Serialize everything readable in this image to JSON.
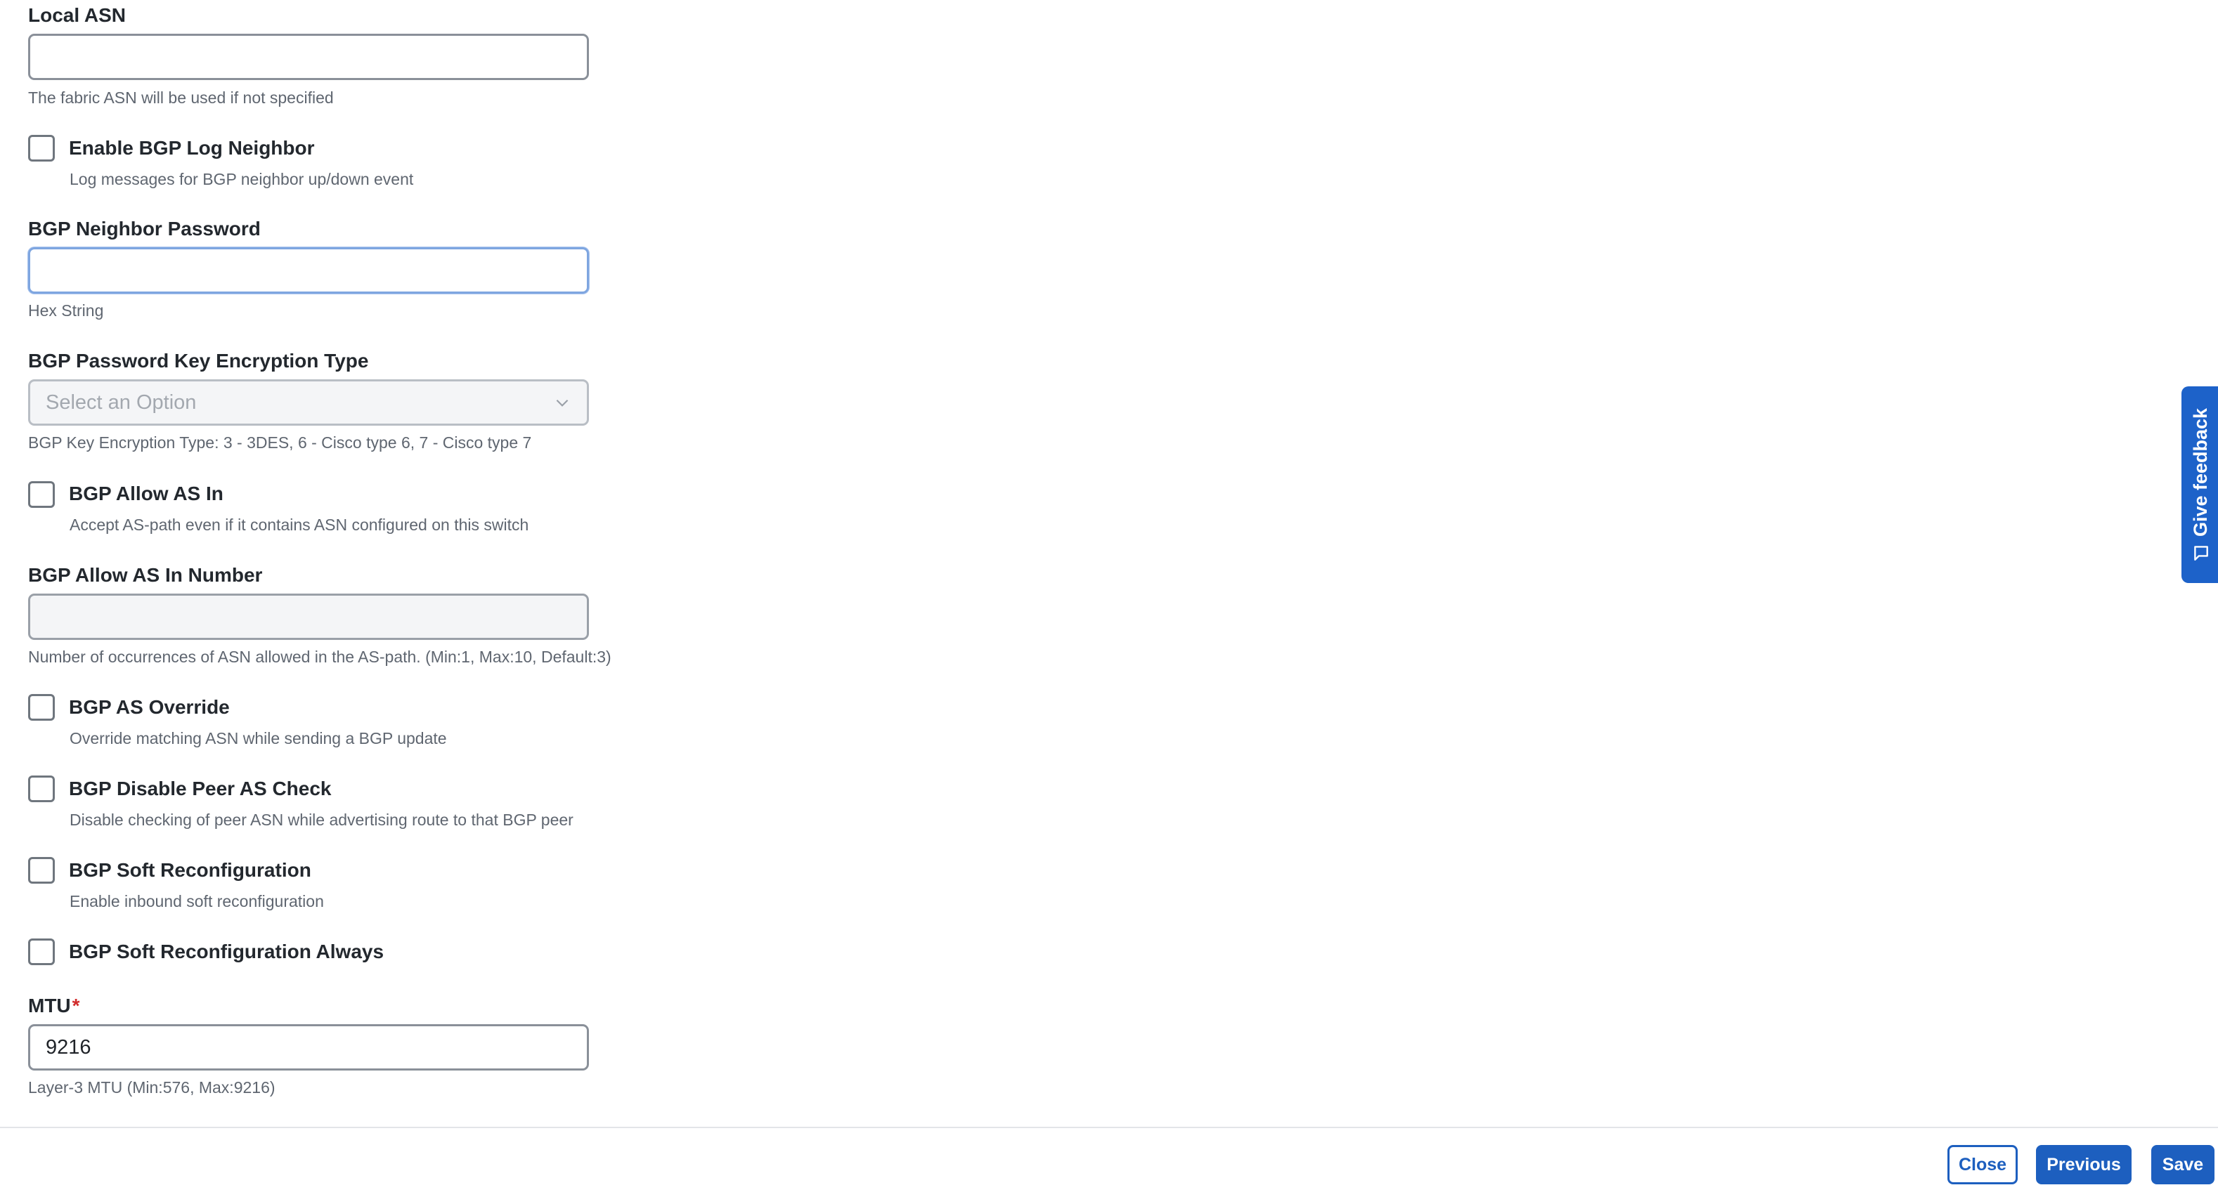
{
  "fields": {
    "local_asn": {
      "label": "Local ASN",
      "value": "",
      "help": "The fabric ASN will be used if not specified"
    },
    "log_neighbor": {
      "label": "Enable BGP Log Neighbor",
      "help": "Log messages for BGP neighbor up/down event",
      "checked": false
    },
    "neighbor_password": {
      "label": "BGP Neighbor Password",
      "value": "",
      "help": "Hex String"
    },
    "key_encryption": {
      "label": "BGP Password Key Encryption Type",
      "placeholder": "Select an Option",
      "help": "BGP Key Encryption Type: 3 - 3DES, 6 - Cisco type 6, 7 - Cisco type 7"
    },
    "allow_as_in": {
      "label": "BGP Allow AS In",
      "help": "Accept AS-path even if it contains ASN configured on this switch",
      "checked": false
    },
    "allow_as_in_number": {
      "label": "BGP Allow AS In Number",
      "value": "",
      "help": "Number of occurrences of ASN allowed in the AS-path. (Min:1, Max:10, Default:3)"
    },
    "as_override": {
      "label": "BGP AS Override",
      "help": "Override matching ASN while sending a BGP update",
      "checked": false
    },
    "disable_peer_as_check": {
      "label": "BGP Disable Peer AS Check",
      "help": "Disable checking of peer ASN while advertising route to that BGP peer",
      "checked": false
    },
    "soft_reconfig": {
      "label": "BGP Soft Reconfiguration",
      "help": "Enable inbound soft reconfiguration",
      "checked": false
    },
    "soft_reconfig_always": {
      "label": "BGP Soft Reconfiguration Always",
      "checked": false
    },
    "mtu": {
      "label": "MTU",
      "required_mark": "*",
      "value": "9216",
      "help": "Layer-3 MTU (Min:576, Max:9216)"
    }
  },
  "footer": {
    "close_label": "Close",
    "previous_label": "Previous",
    "save_label": "Save"
  },
  "feedback_tab": {
    "label": "Give feedback",
    "icon": "feedback-icon"
  },
  "colors": {
    "accent": "#1d5fbf",
    "required": "#d12c2c"
  }
}
